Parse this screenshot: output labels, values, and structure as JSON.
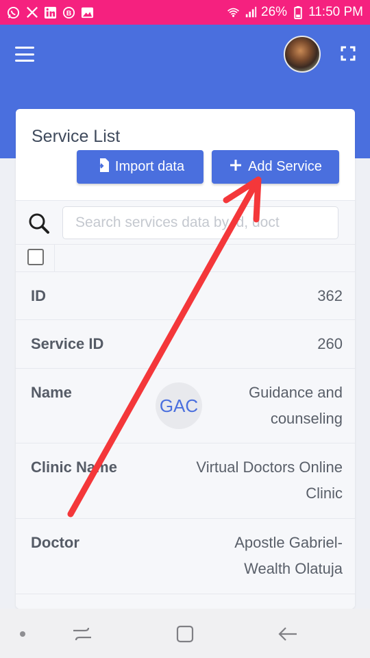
{
  "status_bar": {
    "app_icons": [
      "whatsapp-icon",
      "x-icon",
      "linkedin-icon",
      "b-icon",
      "image-icon"
    ],
    "battery": "26%",
    "time": "11:50 PM",
    "background": "#f5217f"
  },
  "header": {
    "menu_icon": "hamburger-icon",
    "fullscreen_icon": "fullscreen-icon",
    "background": "#4a6fde"
  },
  "card": {
    "title": "Service List",
    "import_button": "Import data",
    "add_button": "Add Service",
    "search_placeholder": "Search services data by id, doct"
  },
  "rows": [
    {
      "label": "ID",
      "value": "362"
    },
    {
      "label": "Service ID",
      "value": "260"
    },
    {
      "label": "Name",
      "badge": "GAC",
      "value_line1": "Guidance and",
      "value_line2": "counseling"
    },
    {
      "label": "Clinic Name",
      "value_line1": "Virtual Doctors Online",
      "value_line2": "Clinic"
    },
    {
      "label": "Doctor",
      "value_line1": "Apostle Gabriel-",
      "value_line2": "Wealth Olatuja"
    }
  ],
  "annotation": {
    "color": "#f4373a",
    "points_to": "add-service-button"
  },
  "nav": {
    "buttons": [
      "recents-icon",
      "home-icon",
      "back-icon"
    ]
  }
}
